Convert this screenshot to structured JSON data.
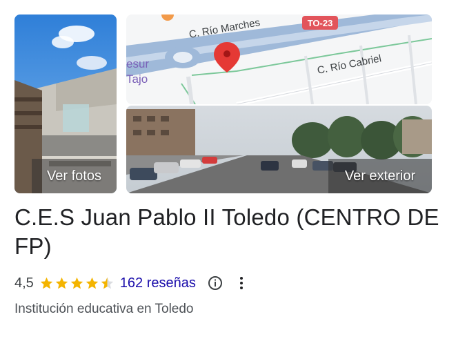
{
  "gallery": {
    "photos_label": "Ver fotos",
    "exterior_label": "Ver exterior"
  },
  "map": {
    "road_label_1": "C. Río Marches",
    "road_label_2": "C. Río Cabriel",
    "highway_badge": "TO-23",
    "area_label_line1": "esur",
    "area_label_line2": "Tajo",
    "colors": {
      "highway_badge": "#e2545b",
      "pin": "#e53935",
      "area_label": "#7b61b8"
    }
  },
  "place": {
    "name": "C.E.S Juan Pablo II Toledo (CENTRO DE FP)",
    "rating": "4,5",
    "rating_stars": 4.5,
    "reviews": "162 reseñas",
    "category": "Institución educativa en Toledo"
  },
  "icons": {
    "info": "info-circle-icon",
    "more": "more-vertical-icon",
    "star": "star-icon",
    "pin": "map-pin-icon"
  },
  "colors": {
    "star": "#f4b400",
    "link": "#1a0dab"
  }
}
